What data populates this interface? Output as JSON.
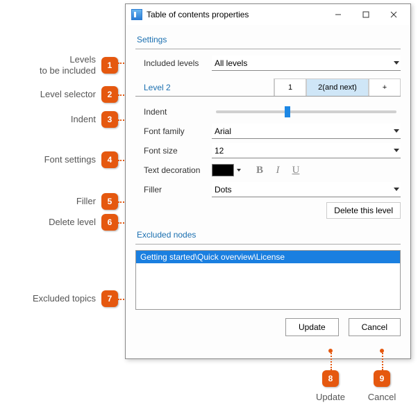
{
  "window": {
    "title": "Table of contents properties"
  },
  "settings": {
    "heading": "Settings",
    "included_label": "Included levels",
    "included_value": "All levels",
    "level_selector": {
      "label": "Level 2",
      "c1": "1",
      "c2": "2(and next)",
      "c3": "+"
    },
    "indent": "Indent",
    "font_family_label": "Font family",
    "font_family_value": "Arial",
    "font_size_label": "Font size",
    "font_size_value": "12",
    "text_decoration": "Text decoration",
    "bold": "B",
    "italic": "I",
    "underline": "U",
    "filler_label": "Filler",
    "filler_value": "Dots",
    "delete_level": "Delete this level"
  },
  "excluded": {
    "heading": "Excluded nodes",
    "item": "Getting started\\Quick overview\\License"
  },
  "buttons": {
    "update": "Update",
    "cancel": "Cancel"
  },
  "callouts": {
    "c1": "Levels\nto be included",
    "c2": "Level selector",
    "c3": "Indent",
    "c4": "Font settings",
    "c5": "Filler",
    "c6": "Delete level",
    "c7": "Excluded topics",
    "c8_num": "8",
    "c9_num": "9",
    "c8": "Update",
    "c9": "Cancel",
    "n1": "1",
    "n2": "2",
    "n3": "3",
    "n4": "4",
    "n5": "5",
    "n6": "6",
    "n7": "7"
  }
}
